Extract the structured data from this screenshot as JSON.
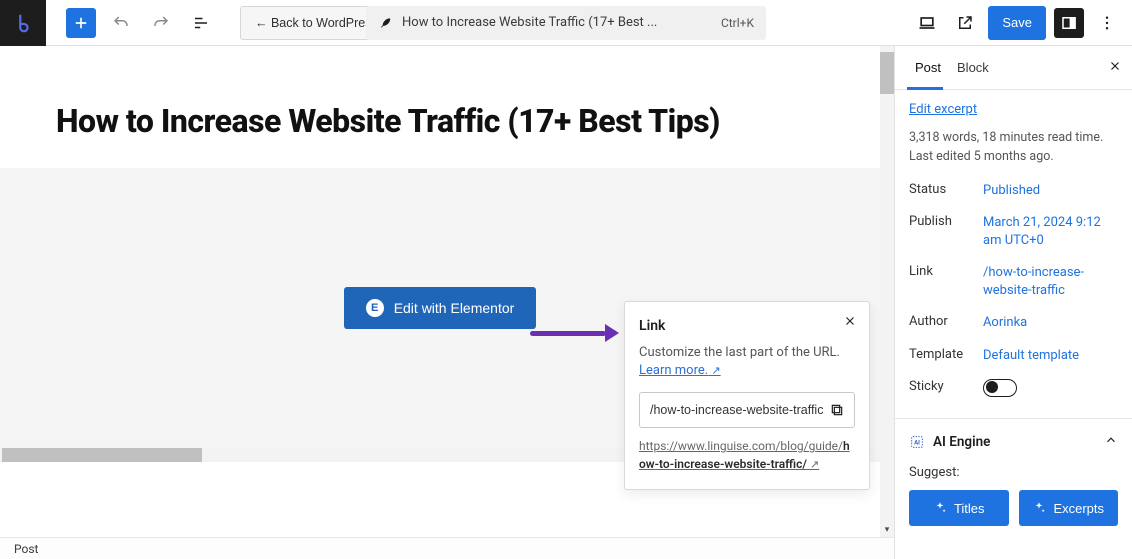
{
  "topbar": {
    "back_label": "← Back to WordPress Editor",
    "doc_title": "How to Increase Website Traffic (17+ Best ...",
    "shortcut": "Ctrl+K",
    "save_label": "Save"
  },
  "post": {
    "heading": "How to Increase Website Traffic (17+ Best Tips)"
  },
  "elementor": {
    "label": "Edit with Elementor",
    "icon_letter": "E"
  },
  "link_popover": {
    "title": "Link",
    "desc_prefix": "Customize the last part of the URL. ",
    "learn_more": "Learn more.",
    "slug_value": "/how-to-increase-website-traffic",
    "permalink_prefix": "https://www.linguise.com/blog/guide/",
    "permalink_slug": "how-to-increase-website-traffic/"
  },
  "sidebar": {
    "tabs": {
      "post": "Post",
      "block": "Block"
    },
    "edit_excerpt": "Edit excerpt",
    "meta1": "3,318 words, 18 minutes read time.",
    "meta2": "Last edited 5 months ago.",
    "rows": {
      "status_k": "Status",
      "status_v": "Published",
      "publish_k": "Publish",
      "publish_v": "March 21, 2024 9:12 am UTC+0",
      "link_k": "Link",
      "link_v": "/how-to-increase-website-traffic",
      "author_k": "Author",
      "author_v": "Aorinka",
      "template_k": "Template",
      "template_v": "Default template",
      "sticky_k": "Sticky"
    },
    "ai": {
      "panel_title": "AI Engine",
      "suggest_label": "Suggest:",
      "titles": "Titles",
      "excerpts": "Excerpts"
    }
  },
  "statusbar": {
    "label": "Post"
  }
}
